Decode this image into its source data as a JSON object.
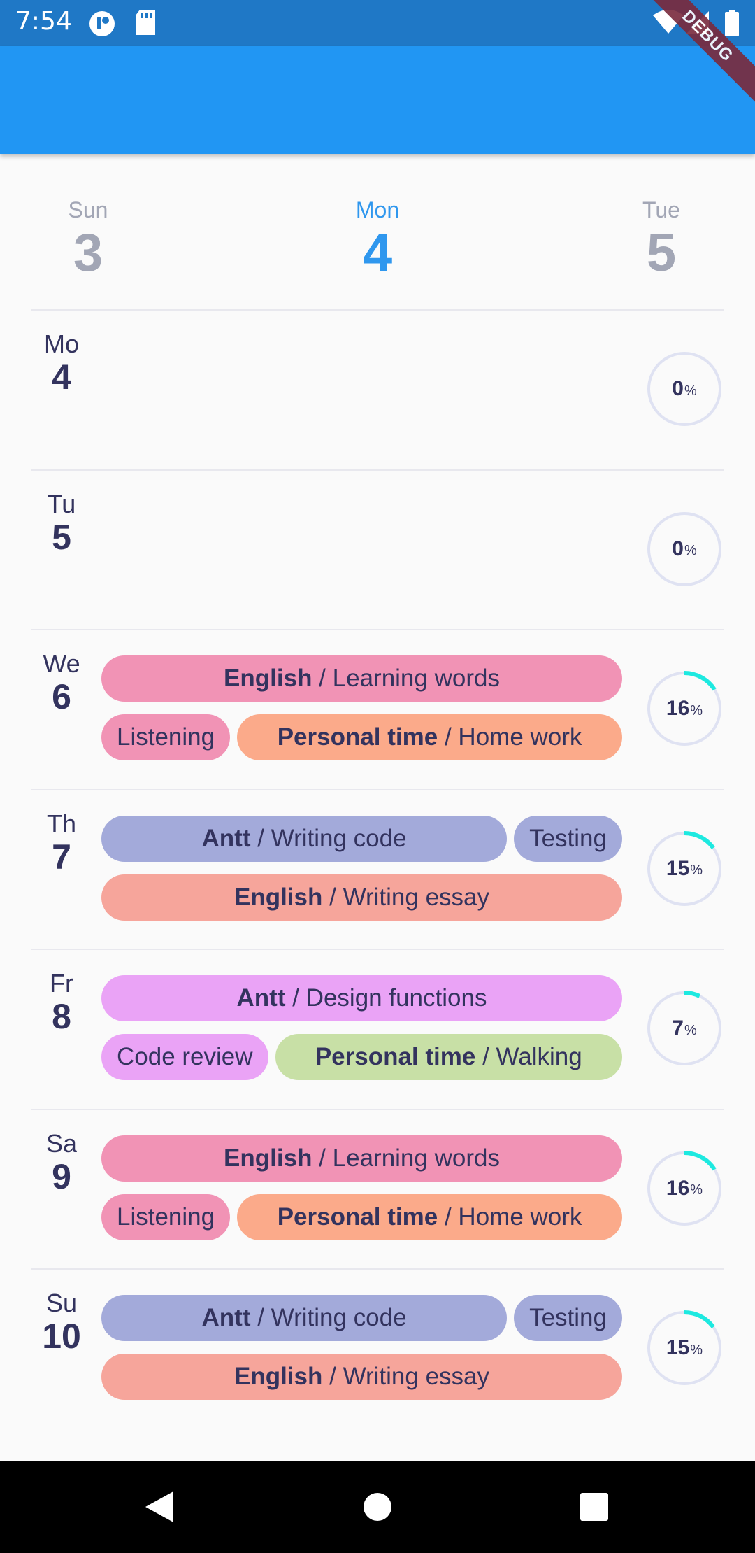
{
  "status_bar": {
    "time": "7:54",
    "icons": [
      "notification-app-icon",
      "sd-card-icon",
      "wifi-icon",
      "signal-icon",
      "battery-icon"
    ],
    "debug_label": "DEBUG",
    "color": "#1f78c6"
  },
  "app_bar": {
    "title": "",
    "color": "#2196f3"
  },
  "week_strip": [
    {
      "name": "Sun",
      "date": "3",
      "active": false
    },
    {
      "name": "Mon",
      "date": "4",
      "active": true
    },
    {
      "name": "Tue",
      "date": "5",
      "active": false
    }
  ],
  "days": [
    {
      "name": "Mo",
      "date": "4",
      "percent": 0,
      "percent_label": "0",
      "unit": "%",
      "chip_lines": []
    },
    {
      "name": "Tu",
      "date": "5",
      "percent": 0,
      "percent_label": "0",
      "unit": "%",
      "chip_lines": []
    },
    {
      "name": "We",
      "date": "6",
      "percent": 16,
      "percent_label": "16",
      "unit": "%",
      "chip_lines": [
        [
          {
            "category": "English",
            "sep": " / ",
            "task": "Learning words",
            "color": "#f193b5"
          }
        ],
        [
          {
            "category": "",
            "sep": "",
            "task": "Listening",
            "color": "#f193b5"
          },
          {
            "category": "Personal time",
            "sep": " / ",
            "task": "Home work",
            "color": "#fbaa8a"
          }
        ]
      ]
    },
    {
      "name": "Th",
      "date": "7",
      "percent": 15,
      "percent_label": "15",
      "unit": "%",
      "chip_lines": [
        [
          {
            "category": "Antt",
            "sep": " / ",
            "task": "Writing code",
            "color": "#a3aada"
          },
          {
            "category": "",
            "sep": "",
            "task": "Testing",
            "color": "#a3aada"
          }
        ],
        [
          {
            "category": "English",
            "sep": " / ",
            "task": "Writing essay",
            "color": "#f6a59b"
          }
        ]
      ]
    },
    {
      "name": "Fr",
      "date": "8",
      "percent": 7,
      "percent_label": "7",
      "unit": "%",
      "chip_lines": [
        [
          {
            "category": "Antt",
            "sep": " / ",
            "task": "Design functions",
            "color": "#eaa3f6"
          }
        ],
        [
          {
            "category": "",
            "sep": "",
            "task": "Code review",
            "color": "#eaa3f6"
          },
          {
            "category": "Personal time",
            "sep": " / ",
            "task": "Walking",
            "color": "#c8e0a6"
          }
        ]
      ]
    },
    {
      "name": "Sa",
      "date": "9",
      "percent": 16,
      "percent_label": "16",
      "unit": "%",
      "chip_lines": [
        [
          {
            "category": "English",
            "sep": " / ",
            "task": "Learning words",
            "color": "#f193b5"
          }
        ],
        [
          {
            "category": "",
            "sep": "",
            "task": "Listening",
            "color": "#f193b5"
          },
          {
            "category": "Personal time",
            "sep": " / ",
            "task": "Home work",
            "color": "#fbaa8a"
          }
        ]
      ]
    },
    {
      "name": "Su",
      "date": "10",
      "percent": 15,
      "percent_label": "15",
      "unit": "%",
      "chip_lines": [
        [
          {
            "category": "Antt",
            "sep": " / ",
            "task": "Writing code",
            "color": "#a3aada"
          },
          {
            "category": "",
            "sep": "",
            "task": "Testing",
            "color": "#a3aada"
          }
        ],
        [
          {
            "category": "English",
            "sep": " / ",
            "task": "Writing essay",
            "color": "#f6a59b"
          }
        ]
      ]
    }
  ],
  "progress_colors": {
    "track": "#dfe2f2",
    "fill": "#1de9e0"
  },
  "nav_bar": {
    "buttons": [
      "back-icon",
      "home-icon",
      "recents-icon"
    ]
  }
}
